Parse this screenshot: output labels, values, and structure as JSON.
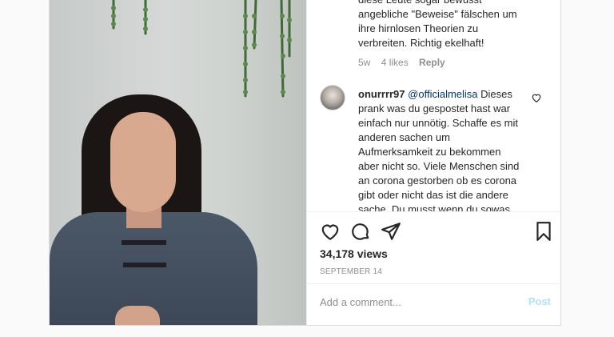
{
  "comments": {
    "first": {
      "text_lines": "diese Leute sogar bewusst angebliche \"Beweise\" fälschen um ihre hirnlosen Theorien zu verbreiten. Richtig ekelhaft!",
      "age": "5w",
      "likes": "4 likes",
      "reply": "Reply"
    },
    "second": {
      "username": "onurrrr97",
      "mention": "@officialmelisa",
      "text": " Dieses prank was du gespostet hast war einfach nur unnötig. Schaffe es mit anderen sachen um Aufmerksamkeit zu bekommen aber nicht so. Viele Menschen sind an corona gestorben ob es corona gibt oder nicht das ist die andere sache. Du musst wenn du sowas"
    }
  },
  "stats": {
    "views": "34,178 views",
    "date": "SEPTEMBER 14"
  },
  "add_comment": {
    "placeholder": "Add a comment...",
    "post_label": "Post"
  },
  "colors": {
    "link": "#00376b",
    "post_disabled": "#b2dffc",
    "muted": "#8e8e8e"
  },
  "icons": [
    "heart-icon",
    "comment-icon",
    "share-icon",
    "bookmark-icon"
  ]
}
